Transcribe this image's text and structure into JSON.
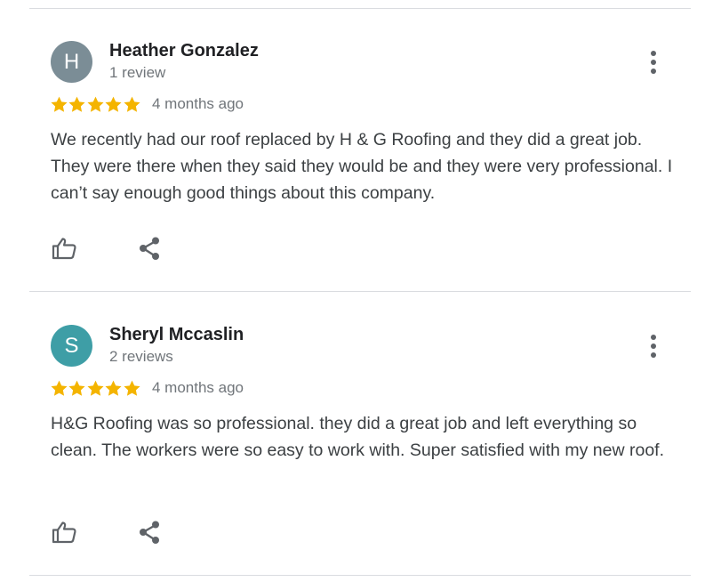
{
  "colors": {
    "star": "#f4b400",
    "avatar_h": "#7b8d96",
    "avatar_s": "#3e9ea6",
    "divider": "#dadce0",
    "icon": "#5f6368"
  },
  "reviews": [
    {
      "avatar_letter": "H",
      "avatar_color": "#7b8d96",
      "name": "Heather Gonzalez",
      "review_count": "1 review",
      "rating": 5,
      "date": "4 months ago",
      "text": "We recently had our roof replaced by H & G Roofing and they did a great job. They were there when they said they would be and they were very professional. I can’t say enough good things about this company.",
      "icons": [
        "more-vert-icon",
        "thumb-up-icon",
        "share-icon"
      ]
    },
    {
      "avatar_letter": "S",
      "avatar_color": "#3e9ea6",
      "name": "Sheryl Mccaslin",
      "review_count": "2 reviews",
      "rating": 5,
      "date": "4 months ago",
      "text": "H&G Roofing was so professional. they did a great job and left everything so clean. The workers were so easy to work with. Super satisfied with my new roof.",
      "icons": [
        "more-vert-icon",
        "thumb-up-icon",
        "share-icon"
      ]
    }
  ]
}
